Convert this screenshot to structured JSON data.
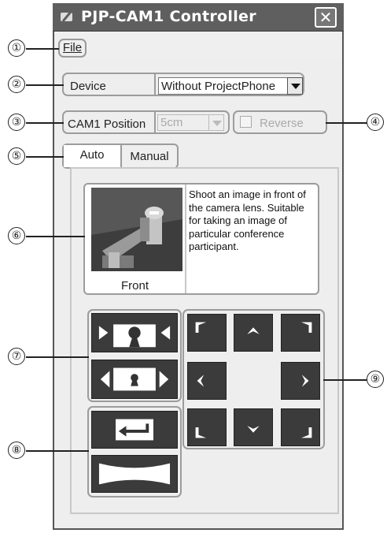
{
  "window": {
    "title": "PJP-CAM1 Controller",
    "close_glyph": "✕"
  },
  "menu": {
    "file": "File"
  },
  "device": {
    "label": "Device",
    "value": "Without ProjectPhone"
  },
  "position": {
    "label": "CAM1 Position",
    "value": "5cm"
  },
  "reverse": {
    "label": "Reverse",
    "checked": false
  },
  "tabs": [
    {
      "label": "Auto",
      "active": true
    },
    {
      "label": "Manual",
      "active": false
    }
  ],
  "preset": {
    "caption": "Front",
    "description": "Shoot an image in front of the camera lens. Suitable for taking an image of particular conference participant."
  },
  "callouts": [
    "①",
    "②",
    "③",
    "④",
    "⑤",
    "⑥",
    "⑦",
    "⑧",
    "⑨"
  ],
  "colors": {
    "title_bar": "#5f5f5f",
    "button_dark": "#3b3b3b",
    "window_bg": "#eeeeee"
  }
}
